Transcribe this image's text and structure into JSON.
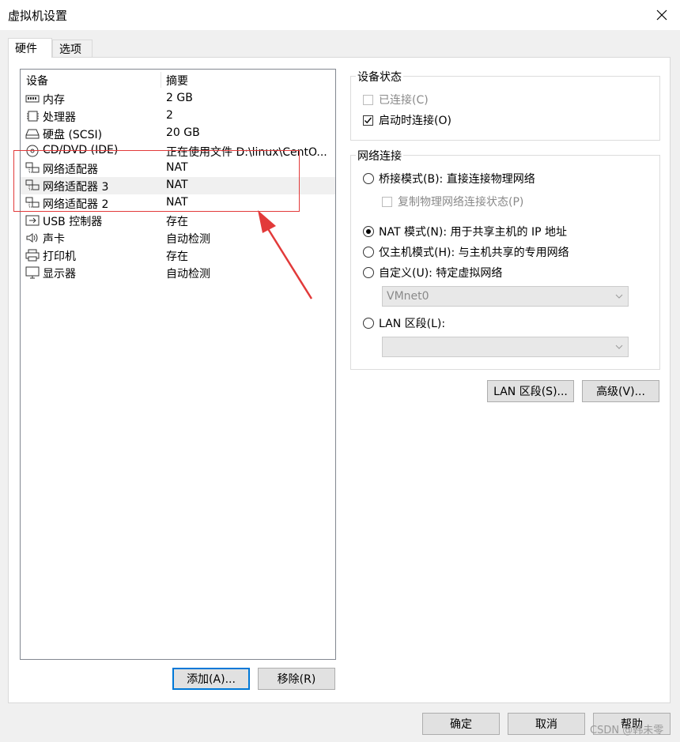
{
  "window": {
    "title": "虚拟机设置"
  },
  "tabs": [
    {
      "label": "硬件"
    },
    {
      "label": "选项"
    }
  ],
  "device_list": {
    "headers": {
      "device": "设备",
      "summary": "摘要"
    },
    "rows": [
      {
        "icon": "memory-icon",
        "name": "内存",
        "summary": "2 GB"
      },
      {
        "icon": "cpu-icon",
        "name": "处理器",
        "summary": "2"
      },
      {
        "icon": "disk-icon",
        "name": "硬盘 (SCSI)",
        "summary": "20 GB"
      },
      {
        "icon": "cd-icon",
        "name": "CD/DVD (IDE)",
        "summary": "正在使用文件 D:\\linux\\CentO..."
      },
      {
        "icon": "network-adapter-icon",
        "name": "网络适配器",
        "summary": "NAT"
      },
      {
        "icon": "network-adapter-icon",
        "name": "网络适配器 3",
        "summary": "NAT"
      },
      {
        "icon": "network-adapter-icon",
        "name": "网络适配器 2",
        "summary": "NAT"
      },
      {
        "icon": "usb-icon",
        "name": "USB 控制器",
        "summary": "存在"
      },
      {
        "icon": "speaker-icon",
        "name": "声卡",
        "summary": "自动检测"
      },
      {
        "icon": "printer-icon",
        "name": "打印机",
        "summary": "存在"
      },
      {
        "icon": "monitor-icon",
        "name": "显示器",
        "summary": "自动检测"
      }
    ],
    "selected_row": "网络适配器 3"
  },
  "device_buttons": {
    "add": "添加(A)...",
    "remove": "移除(R)"
  },
  "device_status": {
    "title": "设备状态",
    "connected": {
      "label": "已连接(C)",
      "checked": false,
      "disabled": true
    },
    "connect_at_power_on": {
      "label": "启动时连接(O)",
      "checked": true
    }
  },
  "network_connection": {
    "title": "网络连接",
    "bridged": {
      "label": "桥接模式(B): 直接连接物理网络",
      "selected": false
    },
    "replicate": {
      "label": "复制物理网络连接状态(P)",
      "checked": false,
      "disabled": true
    },
    "nat": {
      "label": "NAT 模式(N): 用于共享主机的 IP 地址",
      "selected": true
    },
    "host_only": {
      "label": "仅主机模式(H): 与主机共享的专用网络",
      "selected": false
    },
    "custom": {
      "label": "自定义(U): 特定虚拟网络",
      "selected": false
    },
    "custom_select": {
      "value": "VMnet0"
    },
    "lan_segment": {
      "label": "LAN 区段(L):",
      "selected": false
    },
    "lan_select": {
      "value": ""
    }
  },
  "net_buttons": {
    "lan_segments": "LAN 区段(S)...",
    "advanced": "高级(V)..."
  },
  "footer": {
    "ok": "确定",
    "cancel": "取消",
    "help": "帮助"
  },
  "watermark": "CSDN @韩未零",
  "colors": {
    "annotation": "#e23a3a",
    "selection": "#f0f0f0",
    "focus": "#0078d7"
  }
}
